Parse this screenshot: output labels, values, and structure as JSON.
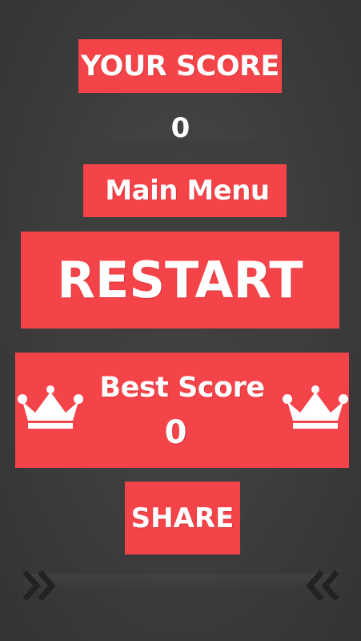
{
  "screen": "game-over",
  "your_score": {
    "title": "YOUR SCORE",
    "value": "0"
  },
  "buttons": {
    "main_menu": "Main Menu",
    "restart": "RESTART",
    "share": "SHARE"
  },
  "best_score": {
    "label": "Best Score",
    "value": "0"
  },
  "icons": {
    "left_crown": "crown-icon",
    "right_crown": "crown-icon",
    "left_arrows": "double-chevron-right-icon",
    "right_arrows": "double-chevron-left-icon"
  },
  "colors": {
    "accent": "#f4444a",
    "background": "#3a3a3a",
    "text": "#ffffff",
    "chevron": "#222222"
  }
}
